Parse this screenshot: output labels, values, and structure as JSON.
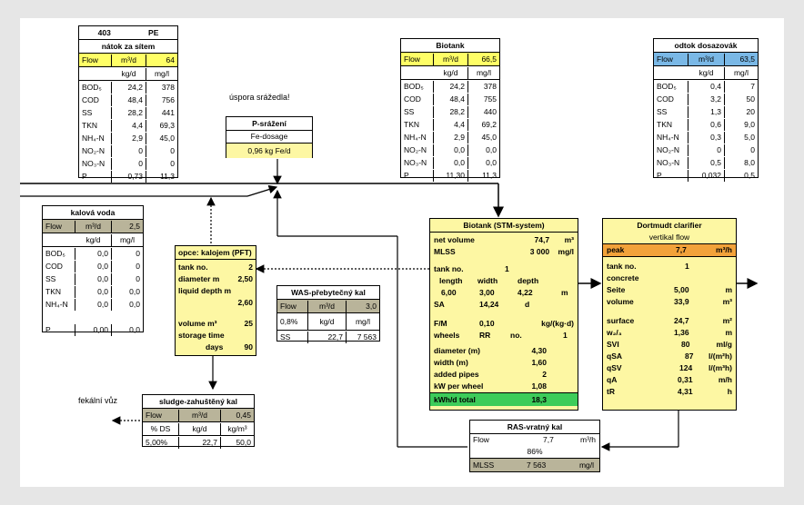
{
  "natok": {
    "top_num": "403",
    "top_pe": "PE",
    "title": "nátok za sítem",
    "flow_label": "Flow",
    "flow_unit": "m³/d",
    "flow_value": "64",
    "unit_kg": "kg/d",
    "unit_mg": "mg/l",
    "rows": [
      {
        "label": "BOD₅",
        "kg": "24,2",
        "mg": "378"
      },
      {
        "label": "COD",
        "kg": "48,4",
        "mg": "756"
      },
      {
        "label": "SS",
        "kg": "28,2",
        "mg": "441"
      },
      {
        "label": "TKN",
        "kg": "4,4",
        "mg": "69,3"
      },
      {
        "label": "NH₄-N",
        "kg": "2,9",
        "mg": "45,0"
      },
      {
        "label": "NO₂-N",
        "kg": "0",
        "mg": "0"
      },
      {
        "label": "NO₃-N",
        "kg": "0",
        "mg": "0"
      },
      {
        "label": "P",
        "kg": "0,73",
        "mg": "11,3"
      }
    ]
  },
  "biotank_in": {
    "title": "Biotank",
    "flow_label": "Flow",
    "flow_unit": "m³/d",
    "flow_value": "66,5",
    "unit_kg": "kg/d",
    "unit_mg": "mg/l",
    "rows": [
      {
        "label": "BOD₅",
        "kg": "24,2",
        "mg": "378"
      },
      {
        "label": "COD",
        "kg": "48,4",
        "mg": "755"
      },
      {
        "label": "SS",
        "kg": "28,2",
        "mg": "440"
      },
      {
        "label": "TKN",
        "kg": "4,4",
        "mg": "69,2"
      },
      {
        "label": "NH₄-N",
        "kg": "2,9",
        "mg": "45,0"
      },
      {
        "label": "NO₂-N",
        "kg": "0,0",
        "mg": "0,0"
      },
      {
        "label": "NO₃-N",
        "kg": "0,0",
        "mg": "0,0"
      },
      {
        "label": "P",
        "kg": "11,30",
        "mg": "11,3"
      }
    ]
  },
  "odtok": {
    "title": "odtok dosazovák",
    "flow_label": "Flow",
    "flow_unit": "m³/d",
    "flow_value": "63,5",
    "unit_kg": "kg/d",
    "unit_mg": "mg/l",
    "rows": [
      {
        "label": "BOD₅",
        "kg": "0,4",
        "mg": "7"
      },
      {
        "label": "COD",
        "kg": "3,2",
        "mg": "50"
      },
      {
        "label": "SS",
        "kg": "1,3",
        "mg": "20"
      },
      {
        "label": "TKN",
        "kg": "0,6",
        "mg": "9,0"
      },
      {
        "label": "NH₄-N",
        "kg": "0,3",
        "mg": "5,0"
      },
      {
        "label": "NO₂-N",
        "kg": "0",
        "mg": "0"
      },
      {
        "label": "NO₃-N",
        "kg": "0,5",
        "mg": "8,0"
      },
      {
        "label": "P",
        "kg": "0,032",
        "mg": "0,5"
      }
    ]
  },
  "kalova": {
    "title": "kalová voda",
    "flow_label": "Flow",
    "flow_unit": "m³/d",
    "flow_value": "2,5",
    "unit_kg": "kg/d",
    "unit_mg": "mg/l",
    "rows": [
      {
        "label": "BOD₅",
        "kg": "0,0",
        "mg": "0"
      },
      {
        "label": "COD",
        "kg": "0,0",
        "mg": "0"
      },
      {
        "label": "SS",
        "kg": "0,0",
        "mg": "0"
      },
      {
        "label": "TKN",
        "kg": "0,0",
        "mg": "0,0"
      },
      {
        "label": "NH₄-N",
        "kg": "0,0",
        "mg": "0,0"
      },
      {
        "label": "",
        "kg": "",
        "mg": ""
      },
      {
        "label": "P",
        "kg": "0,00",
        "mg": "0,0"
      }
    ]
  },
  "labels": {
    "uspora": "úspora srážedla!",
    "fekalni": "fekální vůz"
  },
  "psrazeni": {
    "title": "P-srážení",
    "sub": "Fe-dosage",
    "value": "0,96 kg Fe/d"
  },
  "kalojem": {
    "title": "opce: kalojem (PFT)",
    "tank_label": "tank no.",
    "tank_value": "2",
    "diam_label": "diameter m",
    "diam_value": "2,50",
    "depth_label": "liquid depth m",
    "depth_value": "2,60",
    "vol_label": "volume m³",
    "vol_value": "25",
    "storage_label": "storage time",
    "days_label": "days",
    "days_value": "90"
  },
  "was": {
    "title": "WAS-přebytečný kal",
    "flow_label": "Flow",
    "flow_unit": "m³/d",
    "flow_value": "3,0",
    "pct": "0,8%",
    "unit_kg": "kg/d",
    "unit_mg": "mg/l",
    "ss_label": "SS",
    "ss_kg": "22,7",
    "ss_mg": "7 563"
  },
  "sludge": {
    "title": "sludge-zahuštěný kal",
    "flow_label": "Flow",
    "flow_unit": "m³/d",
    "flow_value": "0,45",
    "ds_label": "% DS",
    "unit_kg": "kg/d",
    "unit_m3": "kg/m³",
    "ds_value": "5,00%",
    "kg_value": "22,7",
    "m3_value": "50,0"
  },
  "stm": {
    "title": "Biotank (STM-system)",
    "netvol_label": "net volume",
    "netvol_value": "74,7",
    "netvol_unit": "m³",
    "mlss_label": "MLSS",
    "mlss_value": "3 000",
    "mlss_unit": "mg/l",
    "tank_label": "tank no.",
    "tank_value": "1",
    "length_label": "length",
    "width_label": "width",
    "depth_label": "depth",
    "length_value": "6,00",
    "width_value": "3,00",
    "depth_value": "4,22",
    "dim_unit": "m",
    "sa_label": "SA",
    "sa_value": "14,24",
    "sa_unit": "d",
    "fm_label": "F/M",
    "fm_value": "0,10",
    "fm_unit": "kg/(kg·d)",
    "wheels_label": "wheels",
    "rr_label": "RR",
    "no_label": "no.",
    "no_value": "1",
    "diam_label": "diameter (m)",
    "diam_value": "4,30",
    "wid_label": "width (m)",
    "wid_value": "1,60",
    "pipes_label": "added pipes",
    "pipes_value": "2",
    "kw_label": "kW per wheel",
    "kw_value": "1,08",
    "kwh_label": "kWh/d total",
    "kwh_value": "18,3"
  },
  "dortmund": {
    "title": "Dortmudt clarifier",
    "subtitle": "vertikal flow",
    "peak_label": "peak",
    "peak_value": "7,7",
    "peak_unit": "m³/h",
    "tank_label": "tank no.",
    "tank_value": "1",
    "concrete": "concrete",
    "seite_label": "Seite",
    "seite_value": "5,00",
    "seite_unit": "m",
    "vol_label": "volume",
    "vol_value": "33,9",
    "vol_unit": "m³",
    "surf_label": "surface",
    "surf_value": "24,7",
    "surf_unit": "m²",
    "w_label": "w₂/₃",
    "w_value": "1,36",
    "w_unit": "m",
    "svi_label": "SVI",
    "svi_value": "80",
    "svi_unit": "ml/g",
    "qsa_label": "qSA",
    "qsa_value": "87",
    "qsa_unit": "l/(m²h)",
    "qsv_label": "qSV",
    "qsv_value": "124",
    "qsv_unit": "l/(m³h)",
    "qa_label": "qA",
    "qa_value": "0,31",
    "qa_unit": "m/h",
    "tr_label": "tR",
    "tr_value": "4,31",
    "tr_unit": "h"
  },
  "ras": {
    "title": "RAS-vratný kal",
    "flow_label": "Flow",
    "flow_value": "7,7",
    "flow_unit": "m³/h",
    "pct": "86%",
    "mlss_label": "MLSS",
    "mlss_value": "7 563",
    "mlss_unit": "mg/l"
  }
}
